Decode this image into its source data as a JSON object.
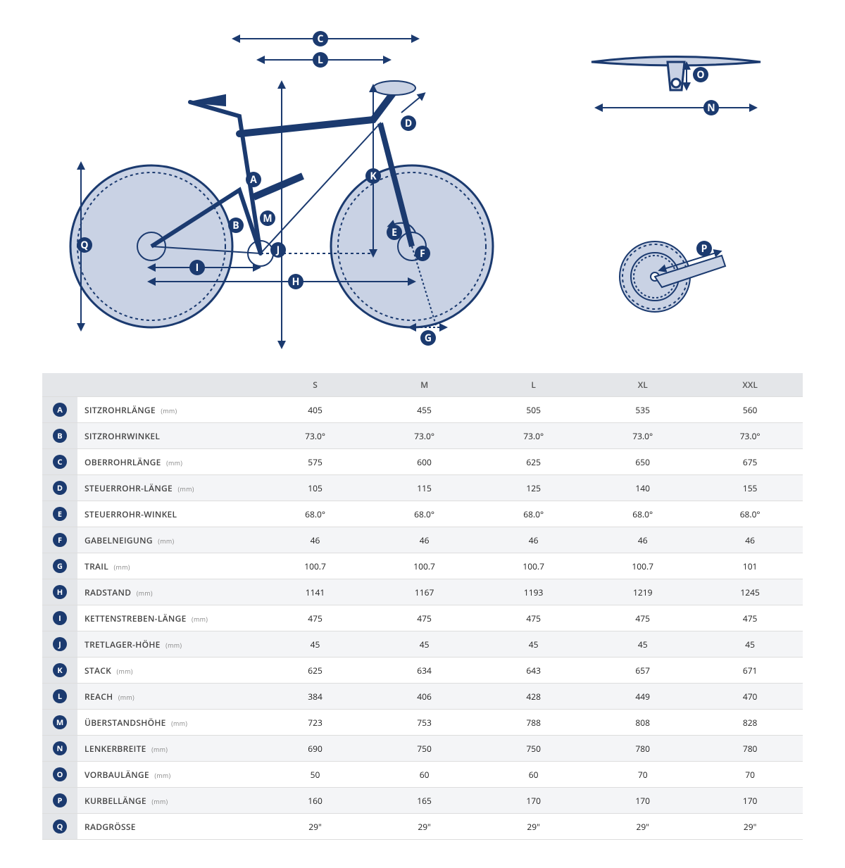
{
  "diagram_labels": [
    "A",
    "B",
    "C",
    "D",
    "E",
    "F",
    "G",
    "H",
    "I",
    "J",
    "K",
    "L",
    "M",
    "N",
    "O",
    "P",
    "Q"
  ],
  "sizes": [
    "S",
    "M",
    "L",
    "XL",
    "XXL"
  ],
  "rows": [
    {
      "key": "A",
      "label": "SITZROHRLÄNGE",
      "unit": "(mm)",
      "vals": [
        "405",
        "455",
        "505",
        "535",
        "560"
      ]
    },
    {
      "key": "B",
      "label": "SITZROHRWINKEL",
      "unit": "",
      "vals": [
        "73.0°",
        "73.0°",
        "73.0°",
        "73.0°",
        "73.0°"
      ]
    },
    {
      "key": "C",
      "label": "OBERROHRLÄNGE",
      "unit": "(mm)",
      "vals": [
        "575",
        "600",
        "625",
        "650",
        "675"
      ]
    },
    {
      "key": "D",
      "label": "STEUERROHR-LÄNGE",
      "unit": "(mm)",
      "vals": [
        "105",
        "115",
        "125",
        "140",
        "155"
      ]
    },
    {
      "key": "E",
      "label": "STEUERROHR-WINKEL",
      "unit": "",
      "vals": [
        "68.0°",
        "68.0°",
        "68.0°",
        "68.0°",
        "68.0°"
      ]
    },
    {
      "key": "F",
      "label": "GABELNEIGUNG",
      "unit": "(mm)",
      "vals": [
        "46",
        "46",
        "46",
        "46",
        "46"
      ]
    },
    {
      "key": "G",
      "label": "TRAIL",
      "unit": "(mm)",
      "vals": [
        "100.7",
        "100.7",
        "100.7",
        "100.7",
        "101"
      ]
    },
    {
      "key": "H",
      "label": "RADSTAND",
      "unit": "(mm)",
      "vals": [
        "1141",
        "1167",
        "1193",
        "1219",
        "1245"
      ]
    },
    {
      "key": "I",
      "label": "KETTENSTREBEN-LÄNGE",
      "unit": "(mm)",
      "vals": [
        "475",
        "475",
        "475",
        "475",
        "475"
      ]
    },
    {
      "key": "J",
      "label": "TRETLAGER-HÖHE",
      "unit": "(mm)",
      "vals": [
        "45",
        "45",
        "45",
        "45",
        "45"
      ]
    },
    {
      "key": "K",
      "label": "STACK",
      "unit": "(mm)",
      "vals": [
        "625",
        "634",
        "643",
        "657",
        "671"
      ]
    },
    {
      "key": "L",
      "label": "REACH",
      "unit": "(mm)",
      "vals": [
        "384",
        "406",
        "428",
        "449",
        "470"
      ]
    },
    {
      "key": "M",
      "label": "ÜBERSTANDSHÖHE",
      "unit": "(mm)",
      "vals": [
        "723",
        "753",
        "788",
        "808",
        "828"
      ]
    },
    {
      "key": "N",
      "label": "LENKERBREITE",
      "unit": "(mm)",
      "vals": [
        "690",
        "750",
        "750",
        "780",
        "780"
      ]
    },
    {
      "key": "O",
      "label": "VORBAULÄNGE",
      "unit": "(mm)",
      "vals": [
        "50",
        "60",
        "60",
        "70",
        "70"
      ]
    },
    {
      "key": "P",
      "label": "KURBELLÄNGE",
      "unit": "(mm)",
      "vals": [
        "160",
        "165",
        "170",
        "170",
        "170"
      ]
    },
    {
      "key": "Q",
      "label": "RADGRÖSSE",
      "unit": "",
      "vals": [
        "29\"",
        "29\"",
        "29\"",
        "29\"",
        "29\""
      ]
    }
  ],
  "colors": {
    "stroke": "#1b3a6f",
    "fill": "#c9d2e4"
  }
}
